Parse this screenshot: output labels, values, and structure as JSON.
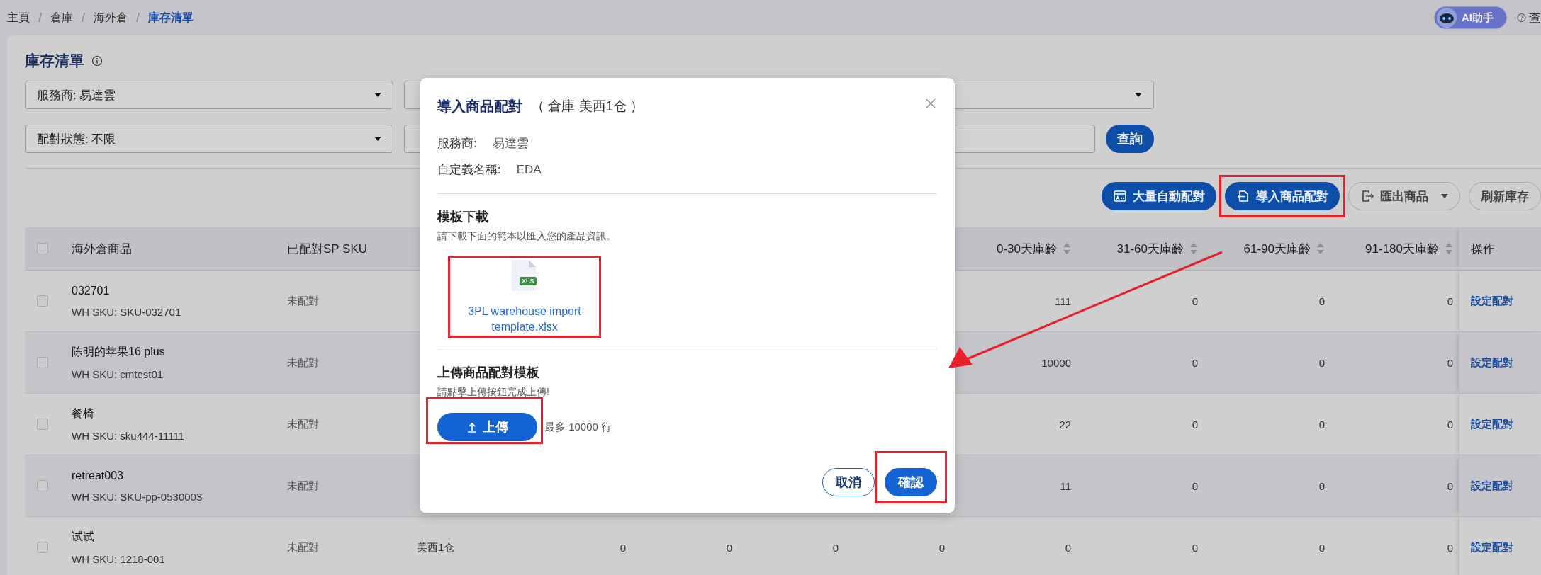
{
  "breadcrumb": [
    {
      "kind": "link",
      "label": "主頁",
      "current": false
    },
    {
      "kind": "separator",
      "label": "/"
    },
    {
      "kind": "link",
      "label": "倉庫",
      "current": false
    },
    {
      "kind": "separator",
      "label": "/"
    },
    {
      "kind": "link",
      "label": "海外倉",
      "current": false
    },
    {
      "kind": "separator",
      "label": "/"
    },
    {
      "kind": "link",
      "label": "庫存清單",
      "current": true
    }
  ],
  "top_bar": {
    "assistant_button": "AI助手",
    "help_link": "查"
  },
  "page": {
    "title": "庫存清單",
    "filters": [
      [
        {
          "kind": "select",
          "value": "服務商: 易達雲"
        },
        {
          "kind": "select"
        }
      ],
      [
        {
          "kind": "select",
          "value": "配對狀態: 不限"
        },
        {
          "kind": "input"
        },
        {
          "kind": "button",
          "label": "查詢"
        }
      ]
    ],
    "toolbar": [
      {
        "label": "大量自動配對",
        "kind": "primary",
        "has_menu": false
      },
      {
        "label": "導入商品配對",
        "kind": "primary",
        "has_menu": false
      },
      {
        "label": "匯出商品",
        "kind": "outline",
        "has_menu": true
      },
      {
        "label": "刷新庫存",
        "kind": "outline",
        "has_menu": false
      }
    ]
  },
  "table": {
    "all_selected": false,
    "columns": [
      {
        "label": "海外倉商品",
        "sortable": false
      },
      {
        "label": "已配對SP SKU",
        "sortable": false
      },
      {
        "label": "0-30天庫齡",
        "sortable": true
      },
      {
        "label": "31-60天庫齡",
        "sortable": true
      },
      {
        "label": "61-90天庫齡",
        "sortable": true
      },
      {
        "label": "91-180天庫齡",
        "sortable": true
      },
      {
        "label": "操作",
        "sortable": false
      }
    ],
    "rows": [
      {
        "selected": false,
        "product": "032701",
        "sku": "WH SKU: SKU-032701",
        "mapped": "未配對",
        "ages": [
          "111",
          "0",
          "0",
          "0"
        ],
        "action": "設定配對"
      },
      {
        "selected": false,
        "product": "陈明的苹果16 plus",
        "sku": "WH SKU: cmtest01",
        "mapped": "未配對",
        "ages": [
          "10000",
          "0",
          "0",
          "0"
        ],
        "action": "設定配對"
      },
      {
        "selected": false,
        "product": "餐椅",
        "sku": "WH SKU: sku444-11111",
        "mapped": "未配對",
        "ages": [
          "22",
          "0",
          "0",
          "0"
        ],
        "action": "設定配對"
      },
      {
        "selected": false,
        "product": "retreat003",
        "sku": "WH SKU: SKU-pp-0530003",
        "mapped": "未配對",
        "ages": [
          "11",
          "0",
          "0",
          "0"
        ],
        "action": "設定配對"
      },
      {
        "selected": false,
        "product": "试试",
        "sku": "WH SKU: 1218-001",
        "mapped": "未配對",
        "column_3": "美西1仓",
        "column_4": "0",
        "column_5": "0",
        "column_6": "0",
        "column_7": "0",
        "ages": [
          "0",
          "0",
          "0",
          "0"
        ],
        "action": "設定配對"
      }
    ]
  },
  "dialog": {
    "title": "導入商品配對",
    "subtitle": "（ 倉庫 美西1仓 ）",
    "fields": [
      {
        "label": "服務商:",
        "value": "易達雲"
      },
      {
        "label": "自定義名稱:",
        "value": "EDA"
      }
    ],
    "download": {
      "heading": "模板下載",
      "description": "請下載下面的範本以匯入您的產品資訊。",
      "file_badge": "XLS",
      "file_name": "3PL warehouse import template.xlsx"
    },
    "upload": {
      "heading": "上傳商品配對模板",
      "description": "請點擊上傳按鈕完成上傳!",
      "button": "上傳",
      "limit": "最多 10000 行"
    },
    "buttons": [
      {
        "label": "取消",
        "kind": "secondary"
      },
      {
        "label": "確認",
        "kind": "primary"
      }
    ]
  }
}
